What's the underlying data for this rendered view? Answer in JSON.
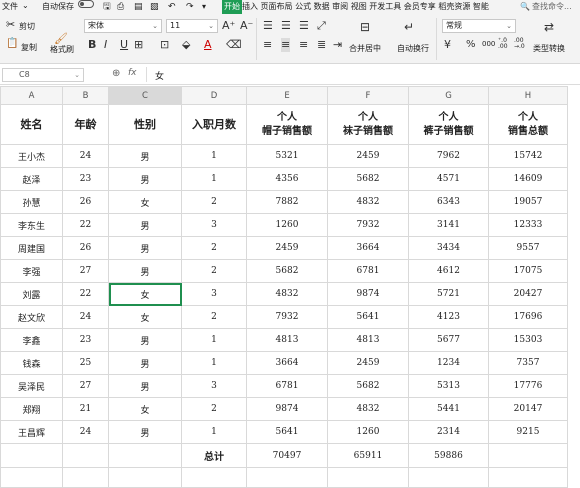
{
  "menubar": {
    "file": "文件",
    "file_arrow": "⌄",
    "autosave": "自动保存",
    "start_tab": "开始",
    "tabs_rest": "插入 页面布局 公式 数据 审阅 视图 开发工具 会员专享 稻壳资源 智能",
    "search": "查找命令..."
  },
  "ribbon": {
    "cut": "剪切",
    "copy": "复制",
    "format_painter": "格式刷",
    "font_name": "宋体",
    "font_size": "11",
    "merge_center": "合并居中",
    "wrap_text": "自动换行",
    "number_format": "常规",
    "currency_symbol": "¥",
    "percent_symbol": "%",
    "thousands_symbol": "000",
    "type_convert": "类型转换",
    "bold": "B",
    "italic": "I",
    "underline": "U",
    "font_color_letter": "A"
  },
  "formula_bar": {
    "cell_ref": "C8",
    "fx_label": "fx",
    "content": "女"
  },
  "columns": [
    "A",
    "B",
    "C",
    "D",
    "E",
    "F",
    "G",
    "H"
  ],
  "header_row": [
    {
      "l1": "姓名",
      "l2": ""
    },
    {
      "l1": "年龄",
      "l2": ""
    },
    {
      "l1": "性别",
      "l2": ""
    },
    {
      "l1": "入职月数",
      "l2": ""
    },
    {
      "l1": "个人",
      "l2": "帽子销售额"
    },
    {
      "l1": "个人",
      "l2": "袜子销售额"
    },
    {
      "l1": "个人",
      "l2": "裤子销售额"
    },
    {
      "l1": "个人",
      "l2": "销售总额"
    }
  ],
  "rows": [
    [
      "王小杰",
      "24",
      "男",
      "1",
      "5321",
      "2459",
      "7962",
      "15742"
    ],
    [
      "赵泽",
      "23",
      "男",
      "1",
      "4356",
      "5682",
      "4571",
      "14609"
    ],
    [
      "孙慧",
      "26",
      "女",
      "2",
      "7882",
      "4832",
      "6343",
      "19057"
    ],
    [
      "李东生",
      "22",
      "男",
      "3",
      "1260",
      "7932",
      "3141",
      "12333"
    ],
    [
      "周建国",
      "26",
      "男",
      "2",
      "2459",
      "3664",
      "3434",
      "9557"
    ],
    [
      "李强",
      "27",
      "男",
      "2",
      "5682",
      "6781",
      "4612",
      "17075"
    ],
    [
      "刘露",
      "22",
      "女",
      "3",
      "4832",
      "9874",
      "5721",
      "20427"
    ],
    [
      "赵文欣",
      "24",
      "女",
      "2",
      "7932",
      "5641",
      "4123",
      "17696"
    ],
    [
      "李鑫",
      "23",
      "男",
      "1",
      "4813",
      "4813",
      "5677",
      "15303"
    ],
    [
      "钱森",
      "25",
      "男",
      "1",
      "3664",
      "2459",
      "1234",
      "7357"
    ],
    [
      "吴泽民",
      "27",
      "男",
      "3",
      "6781",
      "5682",
      "5313",
      "17776"
    ],
    [
      "郑翔",
      "21",
      "女",
      "2",
      "9874",
      "4832",
      "5441",
      "20147"
    ],
    [
      "王昌辉",
      "24",
      "男",
      "1",
      "5641",
      "1260",
      "2314",
      "9215"
    ]
  ],
  "total_row": [
    "",
    "",
    "",
    "总计",
    "70497",
    "65911",
    "59886",
    ""
  ],
  "selection": {
    "row_index": 6,
    "column": "C"
  },
  "colors": {
    "accent": "#1f9d55",
    "selection_border": "#1f8f4f"
  }
}
